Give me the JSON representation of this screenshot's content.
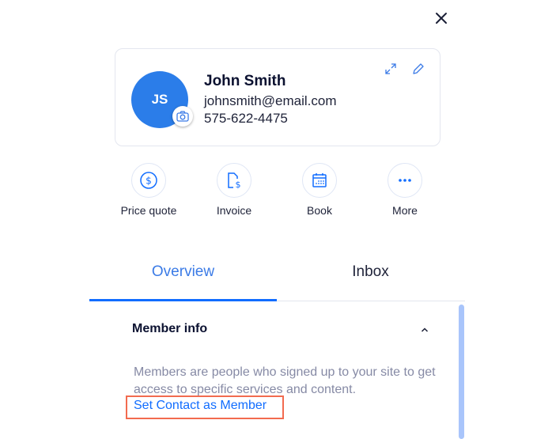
{
  "panel": {
    "close_icon": "close-icon"
  },
  "contact": {
    "initials": "JS",
    "name": "John Smith",
    "email": "johnsmith@email.com",
    "phone": "575-622-4475",
    "avatar_color": "#2b7de9",
    "icons": [
      "camera-icon",
      "expand-icon",
      "edit-pencil-icon"
    ]
  },
  "actions": [
    {
      "label": "Price quote",
      "icon": "dollar-circle-icon"
    },
    {
      "label": "Invoice",
      "icon": "invoice-icon"
    },
    {
      "label": "Book",
      "icon": "calendar-icon"
    },
    {
      "label": "More",
      "icon": "more-dots-icon"
    }
  ],
  "tabs": [
    {
      "label": "Overview",
      "active": true
    },
    {
      "label": "Inbox",
      "active": false
    }
  ],
  "member_info": {
    "title": "Member info",
    "description": "Members are people who signed up to your site to get access to specific services and content.",
    "link_label": "Set Contact as Member",
    "highlight_color": "#f26b4f"
  },
  "colors": {
    "accent": "#116dff",
    "text_dark": "#0b1130",
    "muted": "#868aa5"
  }
}
